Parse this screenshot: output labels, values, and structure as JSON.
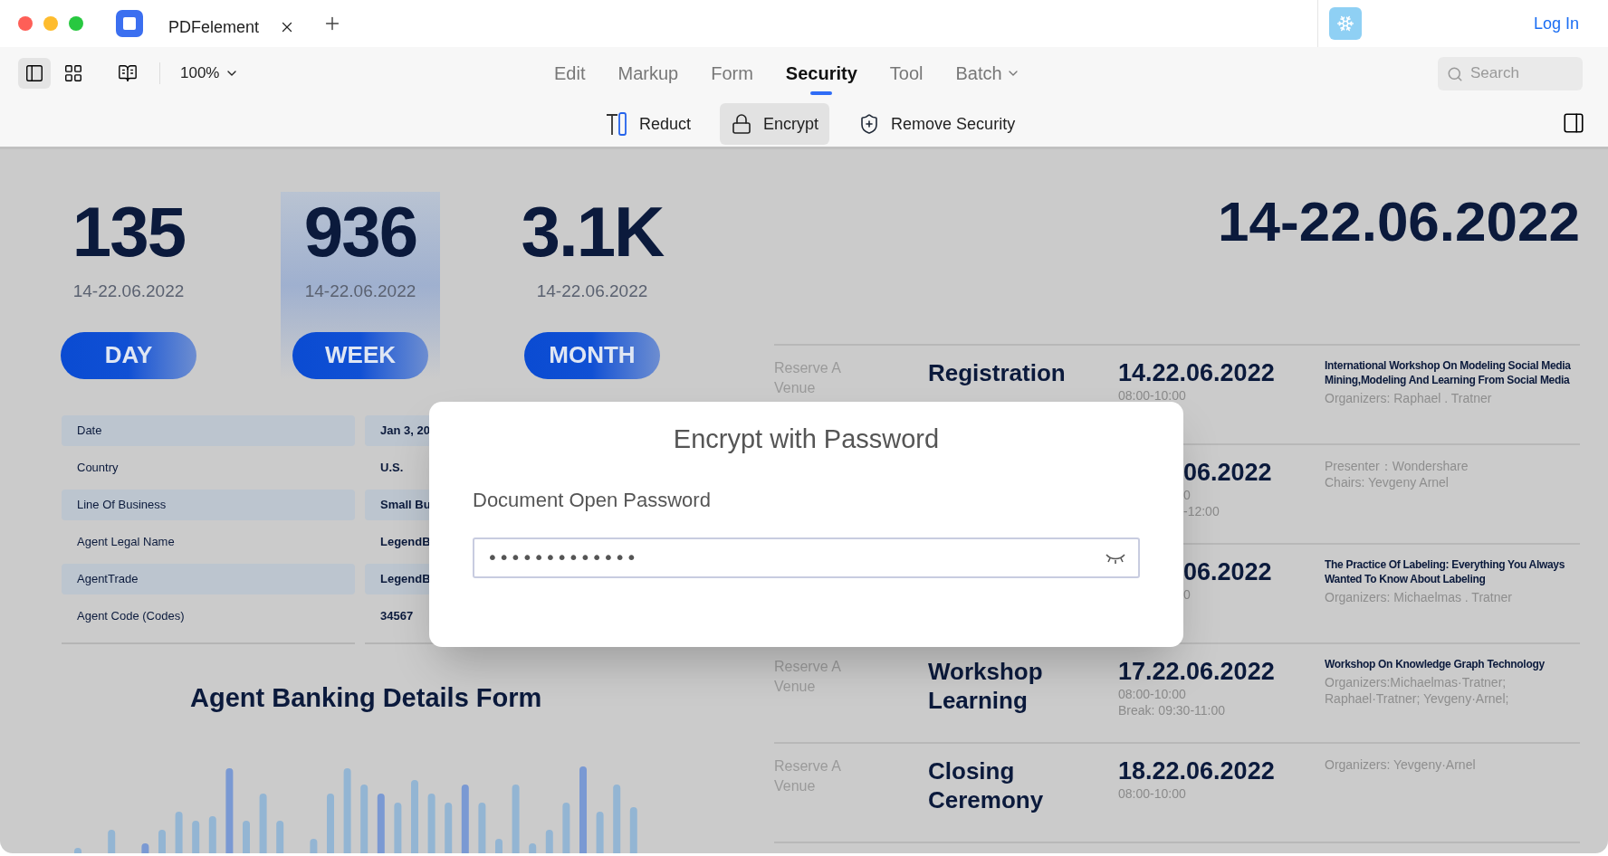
{
  "window": {
    "tab_title": "PDFelement",
    "login": "Log In"
  },
  "toolbar": {
    "zoom": "100%",
    "search": {
      "placeholder": "Search"
    },
    "tabs": [
      {
        "label": "Edit",
        "selected": false,
        "dropdown": false
      },
      {
        "label": "Markup",
        "selected": false,
        "dropdown": false
      },
      {
        "label": "Form",
        "selected": false,
        "dropdown": false
      },
      {
        "label": "Security",
        "selected": true,
        "dropdown": false
      },
      {
        "label": "Tool",
        "selected": false,
        "dropdown": false
      },
      {
        "label": "Batch",
        "selected": false,
        "dropdown": true
      }
    ],
    "tools": [
      {
        "label": "Reduct",
        "selected": false
      },
      {
        "label": "Encrypt",
        "selected": true
      },
      {
        "label": "Remove Security",
        "selected": false
      }
    ]
  },
  "document": {
    "stats": [
      {
        "value": "135",
        "date": "14-22.06.2022",
        "period": "DAY",
        "selected": false
      },
      {
        "value": "936",
        "date": "14-22.06.2022",
        "period": "WEEK",
        "selected": true
      },
      {
        "value": "3.1K",
        "date": "14-22.06.2022",
        "period": "MONTH",
        "selected": false
      }
    ],
    "headline_date": "14-22.06.2022",
    "details": [
      {
        "label": "Date",
        "value": "Jan 3, 20",
        "shaded": true
      },
      {
        "label": "Country",
        "value": "U.S.",
        "shaded": false
      },
      {
        "label": "Line Of Business",
        "value": "Small Bu",
        "shaded": true
      },
      {
        "label": "Agent Legal Name",
        "value": "LegendB",
        "shaded": false
      },
      {
        "label": "AgentTrade",
        "value": "LegendB",
        "shaded": true
      },
      {
        "label": "Agent Code (Codes)",
        "value": "34567",
        "shaded": false
      }
    ],
    "chart_title": "Agent Banking Details Form",
    "schedule": [
      {
        "venue": "Reserve A Venue",
        "title": "Registration",
        "date": "14.22.06.2022",
        "times": [
          "08:00-10:00"
        ],
        "description": "International Workshop On Modeling Social Media Mining,Modeling And Learning From Social Media",
        "notes": [
          "Organizers: Raphael . Tratner"
        ]
      },
      {
        "date": "06.2022",
        "times": [
          "0",
          "-12:00"
        ],
        "notes": [
          "Presenter：Wondershare",
          "Chairs: Yevgeny Arnel"
        ]
      },
      {
        "date": "06.2022",
        "times": [
          "0"
        ],
        "description": "The Practice Of Labeling: Everything You Always Wanted To Know About Labeling",
        "notes": [
          "Organizers: Michaelmas . Tratner"
        ]
      },
      {
        "venue": "Reserve A Venue",
        "title": "Workshop Learning",
        "date": "17.22.06.2022",
        "times": [
          "08:00-10:00",
          "Break: 09:30-11:00"
        ],
        "description": "Workshop On Knowledge Graph Technology",
        "notes": [
          "Organizers:Michaelmas·Tratner;",
          "Raphael·Tratner; Yevgeny·Arnel;"
        ]
      },
      {
        "venue": "Reserve A Venue",
        "title": "Closing Ceremony",
        "date": "18.22.06.2022",
        "times": [
          "08:00-10:00"
        ],
        "notes": [
          "Organizers:  Yevgeny·Arnel"
        ]
      }
    ]
  },
  "dialog": {
    "title": "Encrypt with Password",
    "field_label": "Document Open Password",
    "value": "•••••••••••••"
  }
}
